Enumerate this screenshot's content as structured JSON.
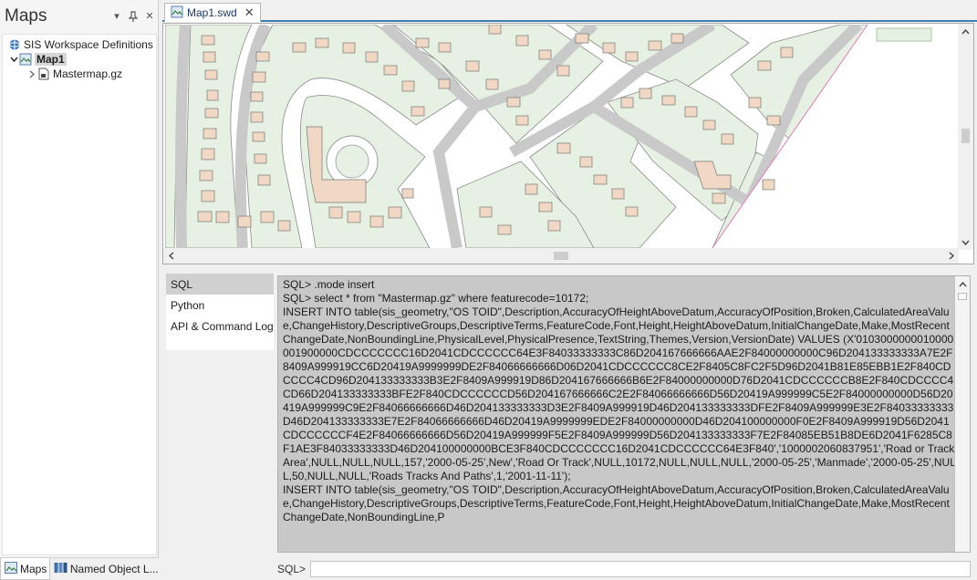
{
  "left_panel": {
    "title": "Maps",
    "tree": {
      "root": "SIS Workspace Definitions",
      "map": "Map1",
      "child": "Mastermap.gz"
    },
    "bottom_tabs": [
      {
        "label": "Maps"
      },
      {
        "label": "Named Object L..."
      }
    ]
  },
  "document": {
    "tab_label": "Map1.swd"
  },
  "console": {
    "languages": [
      "SQL",
      "Python",
      "API & Command Log"
    ],
    "output_lines": [
      "SQL> .mode insert",
      "SQL> select * from \"Mastermap.gz\" where featurecode=10172;",
      "INSERT INTO table(sis_geometry,\"OS TOID\",Description,AccuracyOfHeightAboveDatum,AccuracyOfPosition,Broken,CalculatedAreaValue,ChangeHistory,DescriptiveGroups,DescriptiveTerms,FeatureCode,Font,Height,HeightAboveDatum,InitialChangeDate,Make,MostRecentChangeDate,NonBoundingLine,PhysicalLevel,PhysicalPresence,TextString,Themes,Version,VersionDate) VALUES (X'0103000000010000001900000CDCCCCCCC16D2041CDCCCCCC64E3F84033333333C86D204167666666AAE2F84000000000C96D204133333333A7E2F8409A999919CC6D20419A9999999DE2F84066666666D06D2041CDCCCCCC8CE2F8405C8FC2F5D96D2041B81E85EBB1E2F840CDCCCC4CD96D204133333333B3E2F8409A999919D86D204167666666B6E2F84000000000D76D2041CDCCCCCCB8E2F840CDCCCC4CD66D204133333333BFE2F840CDCCCCCCD56D204167666666C2E2F84066666666D56D20419A999999C5E2F84000000000D56D20419A999999C9E2F84066666666D46D204133333333D3E2F8409A999919D46D204133333333DFE2F8409A999999E3E2F84033333333D46D204133333333E7E2F84066666666D46D20419A9999999EDE2F84000000000D46D204100000000F0E2F8409A999919D56D2041CDCCCCCCF4E2F84066666666D56D20419A999999F5E2F8409A999999D56D204133333333F7E2F84085EB51B8DE6D2041F6285C8F1AE3F84033333333D46D204100000000BCE3F840CDCCCCCCC16D2041CDCCCCCC64E3F840','1000002060837951','Road or Track Area',NULL,NULL,NULL,157,'2000-05-25',New','Road Or Track',NULL,10172,NULL,NULL,NULL,'2000-05-25','Manmade','2000-05-25',NULL,50,NULL,NULL,'Roads Tracks And Paths',1,'2001-11-11');",
      "INSERT INTO table(sis_geometry,\"OS TOID\",Description,AccuracyOfHeightAboveDatum,AccuracyOfPosition,Broken,CalculatedAreaValue,ChangeHistory,DescriptiveGroups,DescriptiveTerms,FeatureCode,Font,Height,HeightAboveDatum,InitialChangeDate,Make,MostRecentChangeDate,NonBoundingLine,P"
    ],
    "prompt_label": "SQL>",
    "input_value": ""
  },
  "colors": {
    "map_block": "#e6f0e3",
    "building": "#f0d8c4",
    "road": "#d2d2d2",
    "outline": "#8a8a8a",
    "accent": "#3c7fb1"
  }
}
